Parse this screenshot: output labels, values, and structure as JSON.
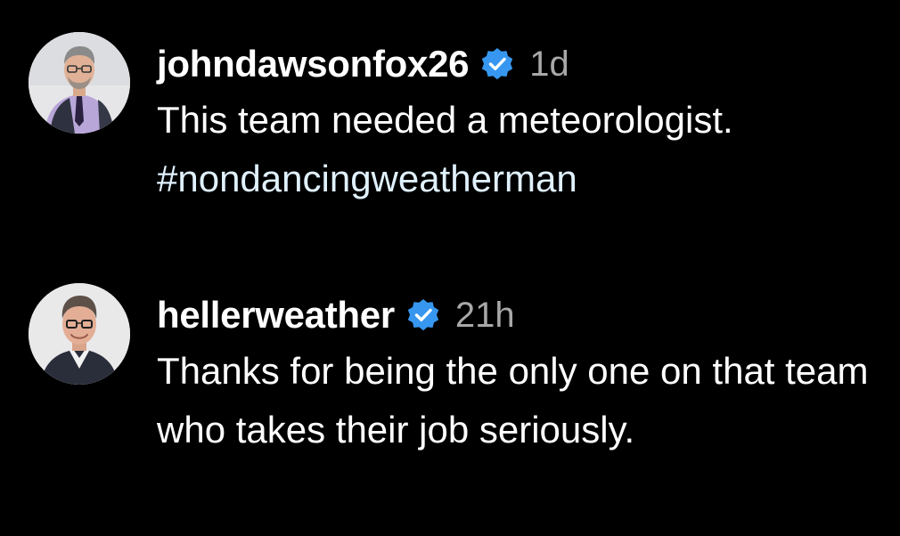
{
  "theme": {
    "background": "#000000",
    "text": "#ffffff",
    "muted": "#a8a8a8",
    "verified_badge": "#3797f0",
    "hashtag": "#e0f1ff"
  },
  "comments": [
    {
      "username": "johndawsonfox26",
      "verified": true,
      "verified_icon": "verified-badge-icon",
      "timestamp": "1d",
      "text": "This team needed a meteorologist.",
      "hashtag": "#nondancingweatherman"
    },
    {
      "username": "hellerweather",
      "verified": true,
      "verified_icon": "verified-badge-icon",
      "timestamp": "21h",
      "text": "Thanks for being the only one on that team who takes their job seriously."
    }
  ]
}
